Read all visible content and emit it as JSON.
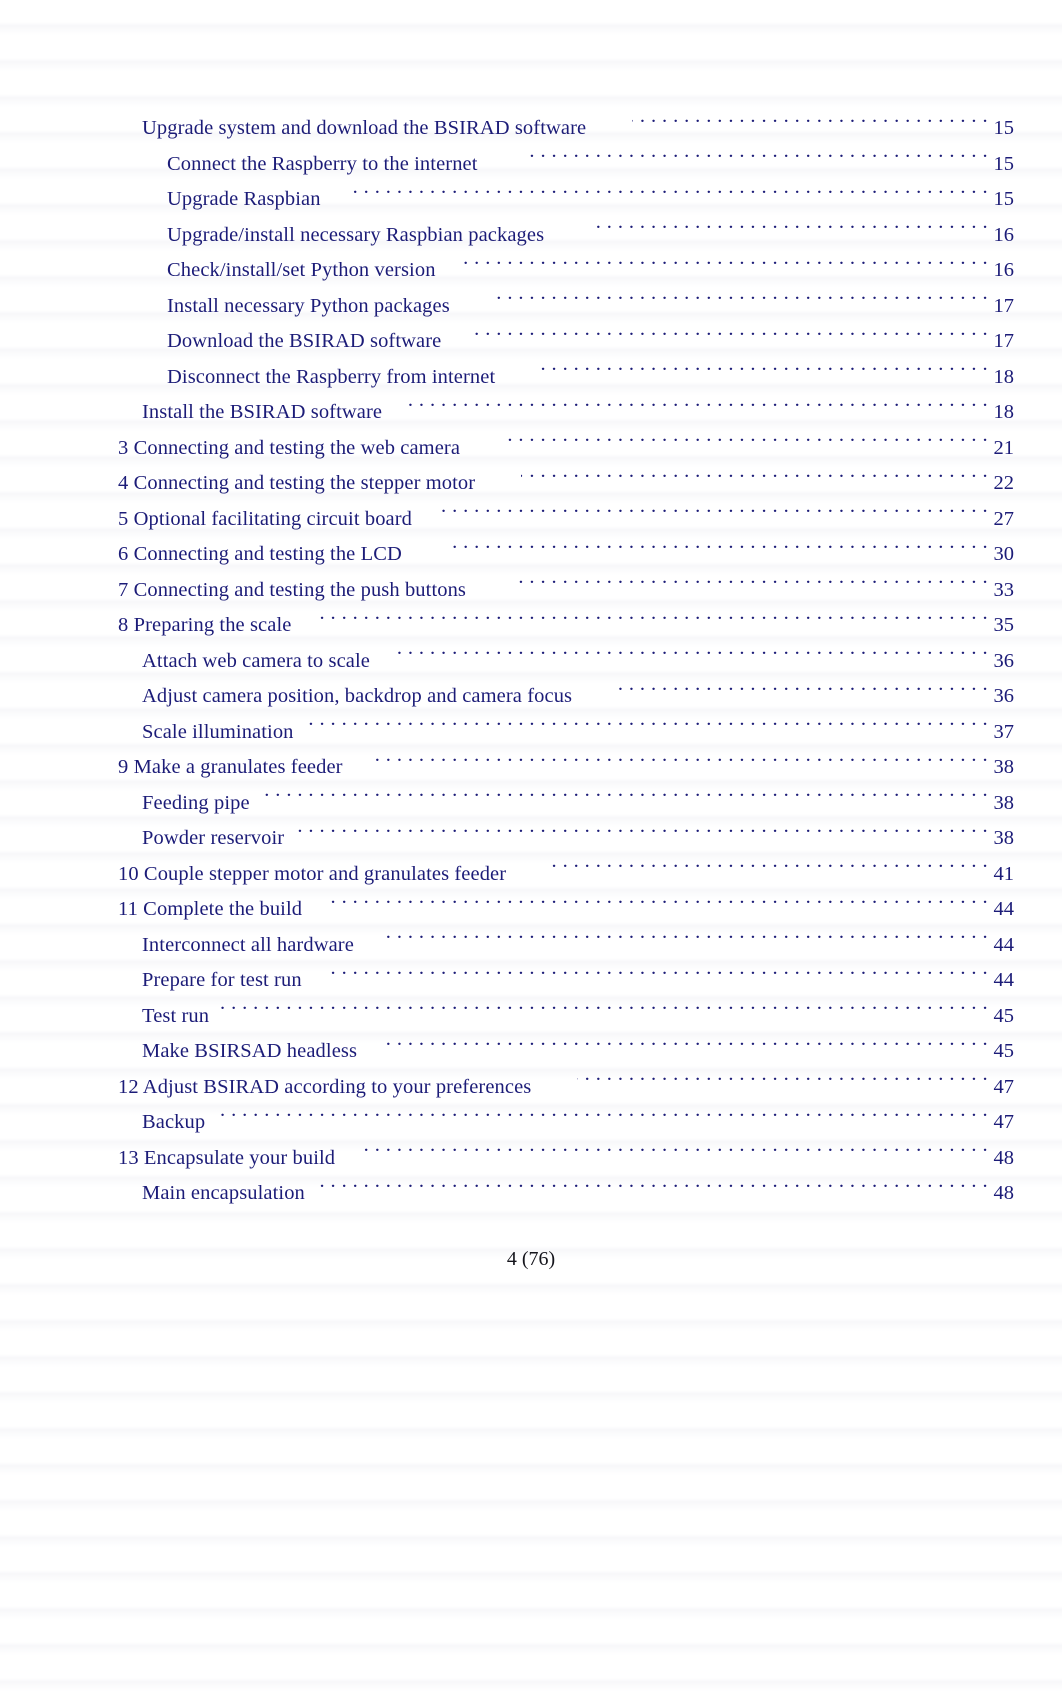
{
  "document": {
    "kind": "table-of-contents",
    "text_color": "#1c1c78",
    "footer_color": "#15151c",
    "background": "#ffffff"
  },
  "toc": {
    "entries": [
      {
        "level": 1,
        "title": "Upgrade system and download the BSIRAD software",
        "page": "15",
        "gap": "gap-lg"
      },
      {
        "level": 2,
        "title": "Connect the Raspberry to the internet",
        "page": "15",
        "gap": "gap-lg"
      },
      {
        "level": 2,
        "title": "Upgrade Raspbian",
        "page": "15",
        "gap": "gap-md"
      },
      {
        "level": 2,
        "title": "Upgrade/install necessary Raspbian packages",
        "page": "16",
        "gap": "gap-lg"
      },
      {
        "level": 2,
        "title": "Check/install/set Python version",
        "page": "16",
        "gap": "gap-md"
      },
      {
        "level": 2,
        "title": "Install necessary Python packages",
        "page": "17",
        "gap": "gap-lg"
      },
      {
        "level": 2,
        "title": "Download the BSIRAD software",
        "page": "17",
        "gap": "gap-md"
      },
      {
        "level": 2,
        "title": "Disconnect the Raspberry from internet",
        "page": "18",
        "gap": "gap-lg"
      },
      {
        "level": 1,
        "title": "Install the BSIRAD software",
        "page": "18",
        "gap": "gap-md"
      },
      {
        "level": 0,
        "title": "3 Connecting and testing the web camera",
        "page": "21",
        "gap": "gap-lg"
      },
      {
        "level": 0,
        "title": "4 Connecting and testing the stepper motor",
        "page": "22",
        "gap": "gap-lg"
      },
      {
        "level": 0,
        "title": "5 Optional facilitating circuit board",
        "page": "27",
        "gap": "gap-md"
      },
      {
        "level": 0,
        "title": "6 Connecting and testing the LCD",
        "page": "30",
        "gap": "gap-lg"
      },
      {
        "level": 0,
        "title": "7 Connecting and testing the push buttons",
        "page": "33",
        "gap": "gap-lg"
      },
      {
        "level": 0,
        "title": "8 Preparing the scale",
        "page": "35",
        "gap": "gap-md"
      },
      {
        "level": 1,
        "title": "Attach web camera to scale",
        "page": "36",
        "gap": "gap-md"
      },
      {
        "level": 1,
        "title": "Adjust camera position, backdrop and camera focus",
        "page": "36",
        "gap": "gap-lg"
      },
      {
        "level": 1,
        "title": "Scale illumination",
        "page": "37",
        "gap": "gap-sm"
      },
      {
        "level": 0,
        "title": "9 Make a granulates feeder",
        "page": "38",
        "gap": "gap-md"
      },
      {
        "level": 1,
        "title": "Feeding pipe",
        "page": "38",
        "gap": "gap-sm"
      },
      {
        "level": 1,
        "title": "Powder reservoir",
        "page": "38",
        "gap": "gap-sm"
      },
      {
        "level": 0,
        "title": "10 Couple stepper motor and granulates feeder",
        "page": "41",
        "gap": "gap-lg"
      },
      {
        "level": 0,
        "title": "11 Complete the build",
        "page": "44",
        "gap": "gap-md"
      },
      {
        "level": 1,
        "title": "Interconnect all hardware",
        "page": "44",
        "gap": "gap-md"
      },
      {
        "level": 1,
        "title": "Prepare for test run",
        "page": "44",
        "gap": "gap-md"
      },
      {
        "level": 1,
        "title": "Test run",
        "page": "45",
        "gap": "gap-sm"
      },
      {
        "level": 1,
        "title": "Make BSIRSAD headless",
        "page": "45",
        "gap": "gap-md"
      },
      {
        "level": 0,
        "title": "12 Adjust BSIRAD according to your preferences",
        "page": "47",
        "gap": "gap-lg"
      },
      {
        "level": 1,
        "title": "Backup",
        "page": "47",
        "gap": "gap-sm"
      },
      {
        "level": 0,
        "title": "13 Encapsulate your build",
        "page": "48",
        "gap": "gap-md"
      },
      {
        "level": 1,
        "title": "Main encapsulation",
        "page": "48",
        "gap": "gap-sm"
      }
    ]
  },
  "footer": {
    "page_label": "4 (76)"
  }
}
